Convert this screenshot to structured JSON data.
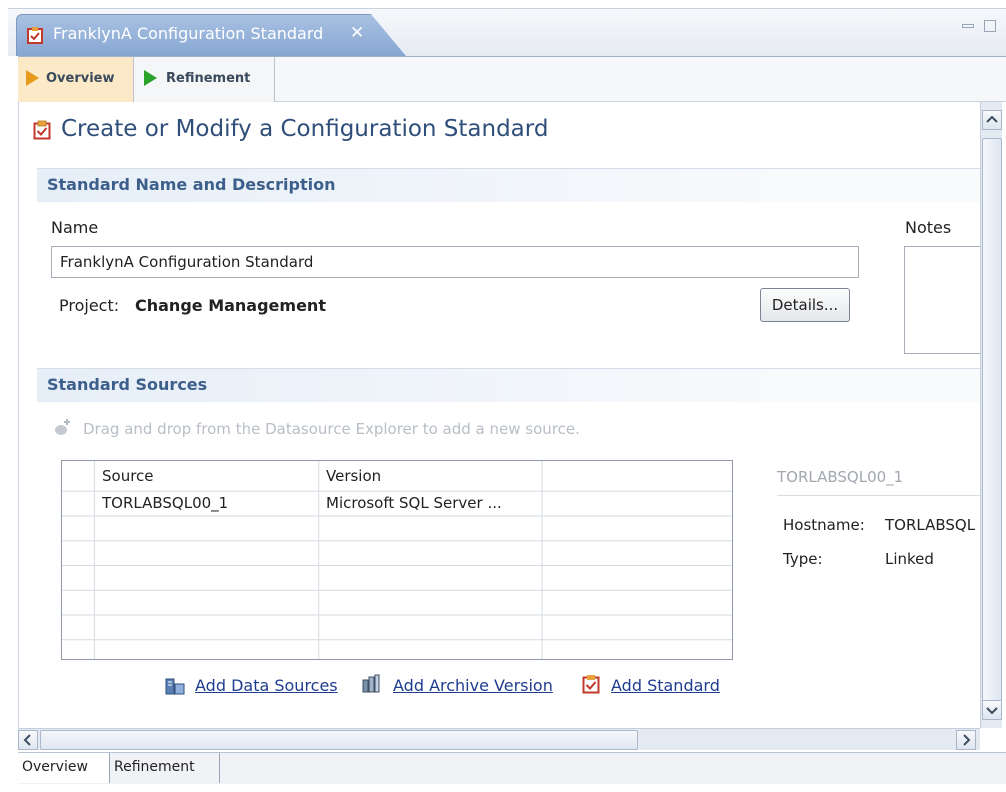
{
  "editor_tab": {
    "title": "FranklynA Configuration Standard",
    "close": "✕"
  },
  "page_tabs": [
    {
      "label": "Overview"
    },
    {
      "label": "Refinement"
    }
  ],
  "page": {
    "title": "Create or Modify a Configuration Standard",
    "section_name": {
      "header": "Standard Name and Description",
      "name_label": "Name",
      "name_value": "FranklynA Configuration Standard",
      "project_label": "Project:",
      "project_value": "Change Management",
      "details_button": "Details...",
      "notes_label": "Notes"
    },
    "section_sources": {
      "header": "Standard Sources",
      "drag_hint": "Drag and drop from the Datasource Explorer to add a new source.",
      "table": {
        "columns": [
          "Source",
          "Version"
        ],
        "rows": [
          {
            "source": "TORLABSQL00_1",
            "version": "Microsoft SQL Server ..."
          }
        ]
      },
      "details": {
        "title": "TORLABSQL00_1",
        "hostname_label": "Hostname:",
        "hostname_value": "TORLABSQL",
        "type_label": "Type:",
        "type_value": "Linked"
      },
      "links": {
        "add_data_sources": "Add Data Sources",
        "add_archive_version": "Add Archive Version",
        "add_standard": "Add Standard"
      }
    }
  },
  "bottom_tabs": [
    {
      "label": "Overview"
    },
    {
      "label": "Refinement"
    }
  ],
  "colors": {
    "accent": "#2f4e7a",
    "section_text": "#3d5f8c",
    "link": "#1f3d8f",
    "tab_active": "#fbe9c7",
    "play_green": "#2aa32a",
    "play_orange": "#e79a1c"
  }
}
